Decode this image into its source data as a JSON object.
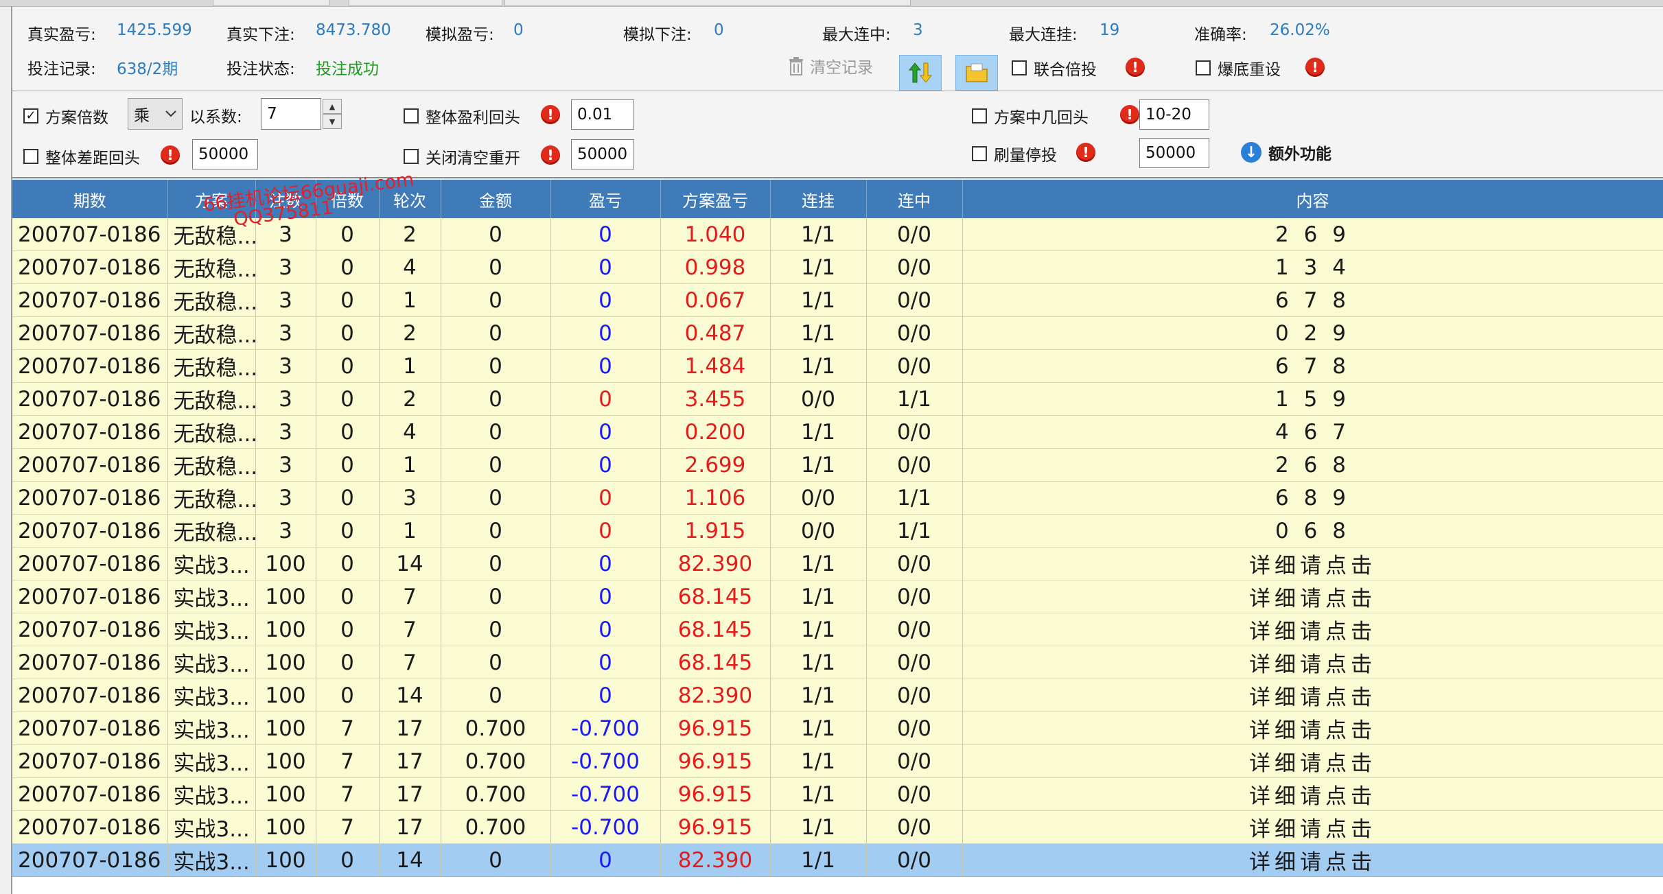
{
  "stats": {
    "real_pl_label": "真实盈亏:",
    "real_pl_value": "1425.599",
    "real_bet_label": "真实下注:",
    "real_bet_value": "8473.780",
    "sim_pl_label": "模拟盈亏:",
    "sim_pl_value": "0",
    "sim_bet_label": "模拟下注:",
    "sim_bet_value": "0",
    "max_win_streak_label": "最大连中:",
    "max_win_streak_value": "3",
    "max_loss_streak_label": "最大连挂:",
    "max_loss_streak_value": "19",
    "accuracy_label": "准确率:",
    "accuracy_value": "26.02%",
    "record_label": "投注记录:",
    "record_value": "638/2期",
    "status_label": "投注状态:",
    "status_value": "投注成功",
    "clear_label": "清空记录",
    "joint_label": "联合倍投",
    "bust_reset_label": "爆底重设"
  },
  "settings": {
    "plan_multiplier_label": "方案倍数",
    "mode_value": "乘",
    "coef_label": "以系数:",
    "coef_value": "7",
    "overall_profit_return_label": "整体盈利回头",
    "overall_profit_return_value": "0.01",
    "plan_hit_return_label": "方案中几回头",
    "plan_hit_return_value": "10-20",
    "overall_diff_return_label": "整体差距回头",
    "overall_diff_return_value": "50000",
    "close_clear_restart_label": "关闭清空重开",
    "close_clear_restart_value": "50000",
    "brush_stop_label": "刷量停投",
    "brush_stop_value": "50000",
    "extra_label": "额外功能"
  },
  "watermark": {
    "line1": "66挂机论坛66guaji.com",
    "line2": "QQ375811"
  },
  "table": {
    "headers": [
      "期数",
      "方案",
      "注数",
      "倍数",
      "轮次",
      "金额",
      "盈亏",
      "方案盈亏",
      "连挂",
      "连中",
      "内容"
    ],
    "rows": [
      [
        "200707-0186",
        "无敌稳...",
        "3",
        "0",
        "2",
        "0",
        "0",
        "1.040",
        "1/1",
        "0/0",
        "2 6 9"
      ],
      [
        "200707-0186",
        "无敌稳...",
        "3",
        "0",
        "4",
        "0",
        "0",
        "0.998",
        "1/1",
        "0/0",
        "1 3 4"
      ],
      [
        "200707-0186",
        "无敌稳...",
        "3",
        "0",
        "1",
        "0",
        "0",
        "0.067",
        "1/1",
        "0/0",
        "6 7 8"
      ],
      [
        "200707-0186",
        "无敌稳...",
        "3",
        "0",
        "2",
        "0",
        "0",
        "0.487",
        "1/1",
        "0/0",
        "0 2 9"
      ],
      [
        "200707-0186",
        "无敌稳...",
        "3",
        "0",
        "1",
        "0",
        "0",
        "1.484",
        "1/1",
        "0/0",
        "6 7 8"
      ],
      [
        "200707-0186",
        "无敌稳...",
        "3",
        "0",
        "2",
        "0",
        "0",
        "3.455",
        "0/0",
        "1/1",
        "1 5 9"
      ],
      [
        "200707-0186",
        "无敌稳...",
        "3",
        "0",
        "4",
        "0",
        "0",
        "0.200",
        "1/1",
        "0/0",
        "4 6 7"
      ],
      [
        "200707-0186",
        "无敌稳...",
        "3",
        "0",
        "1",
        "0",
        "0",
        "2.699",
        "1/1",
        "0/0",
        "2 6 8"
      ],
      [
        "200707-0186",
        "无敌稳...",
        "3",
        "0",
        "3",
        "0",
        "0",
        "1.106",
        "0/0",
        "1/1",
        "6 8 9"
      ],
      [
        "200707-0186",
        "无敌稳...",
        "3",
        "0",
        "1",
        "0",
        "0",
        "1.915",
        "0/0",
        "1/1",
        "0 6 8"
      ],
      [
        "200707-0186",
        "实战3...",
        "100",
        "0",
        "14",
        "0",
        "0",
        "82.390",
        "1/1",
        "0/0",
        "详细请点击"
      ],
      [
        "200707-0186",
        "实战3...",
        "100",
        "0",
        "7",
        "0",
        "0",
        "68.145",
        "1/1",
        "0/0",
        "详细请点击"
      ],
      [
        "200707-0186",
        "实战3...",
        "100",
        "0",
        "7",
        "0",
        "0",
        "68.145",
        "1/1",
        "0/0",
        "详细请点击"
      ],
      [
        "200707-0186",
        "实战3...",
        "100",
        "0",
        "7",
        "0",
        "0",
        "68.145",
        "1/1",
        "0/0",
        "详细请点击"
      ],
      [
        "200707-0186",
        "实战3...",
        "100",
        "0",
        "14",
        "0",
        "0",
        "82.390",
        "1/1",
        "0/0",
        "详细请点击"
      ],
      [
        "200707-0186",
        "实战3...",
        "100",
        "7",
        "17",
        "0.700",
        "-0.700",
        "96.915",
        "1/1",
        "0/0",
        "详细请点击"
      ],
      [
        "200707-0186",
        "实战3...",
        "100",
        "7",
        "17",
        "0.700",
        "-0.700",
        "96.915",
        "1/1",
        "0/0",
        "详细请点击"
      ],
      [
        "200707-0186",
        "实战3...",
        "100",
        "7",
        "17",
        "0.700",
        "-0.700",
        "96.915",
        "1/1",
        "0/0",
        "详细请点击"
      ],
      [
        "200707-0186",
        "实战3...",
        "100",
        "7",
        "17",
        "0.700",
        "-0.700",
        "96.915",
        "1/1",
        "0/0",
        "详细请点击"
      ],
      [
        "200707-0186",
        "实战3...",
        "100",
        "0",
        "14",
        "0",
        "0",
        "82.390",
        "1/1",
        "0/0",
        "详细请点击"
      ]
    ],
    "pl_colors": [
      "blue",
      "blue",
      "blue",
      "blue",
      "blue",
      "red",
      "blue",
      "blue",
      "red",
      "red",
      "blue",
      "blue",
      "blue",
      "blue",
      "blue",
      "blue",
      "blue",
      "blue",
      "blue",
      "blue"
    ],
    "selected_index": 19
  },
  "colors": {
    "header_bg": "#3f7ab9",
    "row_bg": "#fafad3",
    "selected_bg": "#a2ccf2",
    "value_blue": "#2b7bc2",
    "status_green": "#1e9a22"
  }
}
